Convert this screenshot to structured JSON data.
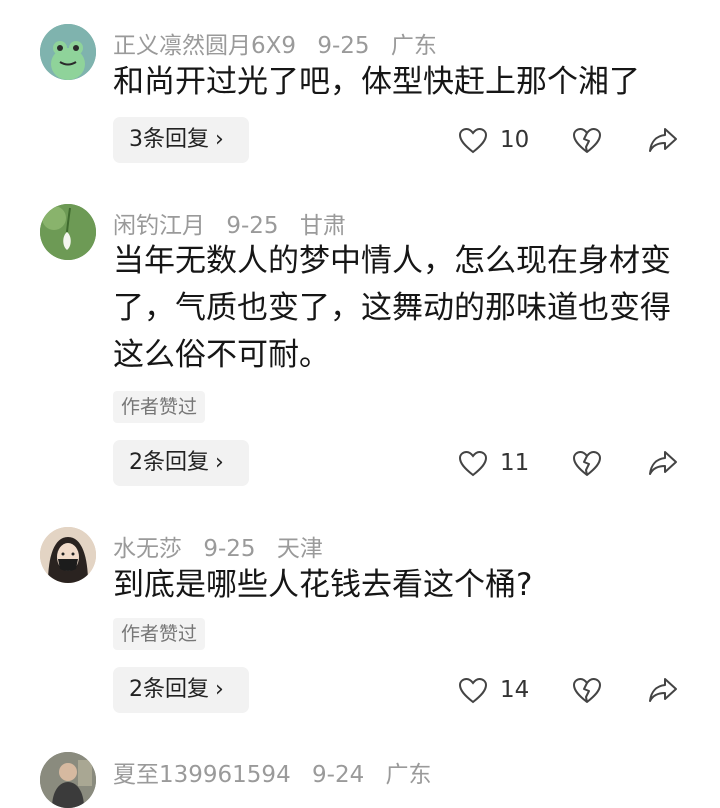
{
  "comments": [
    {
      "username": "正义凛然圆月6X9",
      "date": "9-25",
      "location": "广东",
      "text": "和尚开过光了吧，体型快赶上那个湘了",
      "author_liked": "",
      "replies_label": "3条回复",
      "likes": "10",
      "avatar_icon": "frog-avatar",
      "avatar_color": "#6fa3a0"
    },
    {
      "username": "闲钓江月",
      "date": "9-25",
      "location": "甘肃",
      "text": "当年无数人的梦中情人，怎么现在身材变了，气质也变了，这舞动的那味道也变得这么俗不可耐。",
      "author_liked": "作者赞过",
      "replies_label": "2条回复",
      "likes": "11",
      "avatar_icon": "snowdrop-flower-avatar",
      "avatar_color": "#5f8a4c"
    },
    {
      "username": "水无莎",
      "date": "9-25",
      "location": "天津",
      "text": "到底是哪些人花钱去看这个桶?",
      "author_liked": "作者赞过",
      "replies_label": "2条回复",
      "likes": "14",
      "avatar_icon": "girl-with-mask-avatar",
      "avatar_color": "#d9c7b4"
    },
    {
      "username": "夏至139961594",
      "date": "9-24",
      "location": "广东",
      "avatar_icon": "person-photo-avatar",
      "avatar_color": "#7d7f72"
    }
  ],
  "colors": {
    "meta_text": "#9a9a9a",
    "body_text": "#161616",
    "button_bg": "#f2f2f2"
  }
}
